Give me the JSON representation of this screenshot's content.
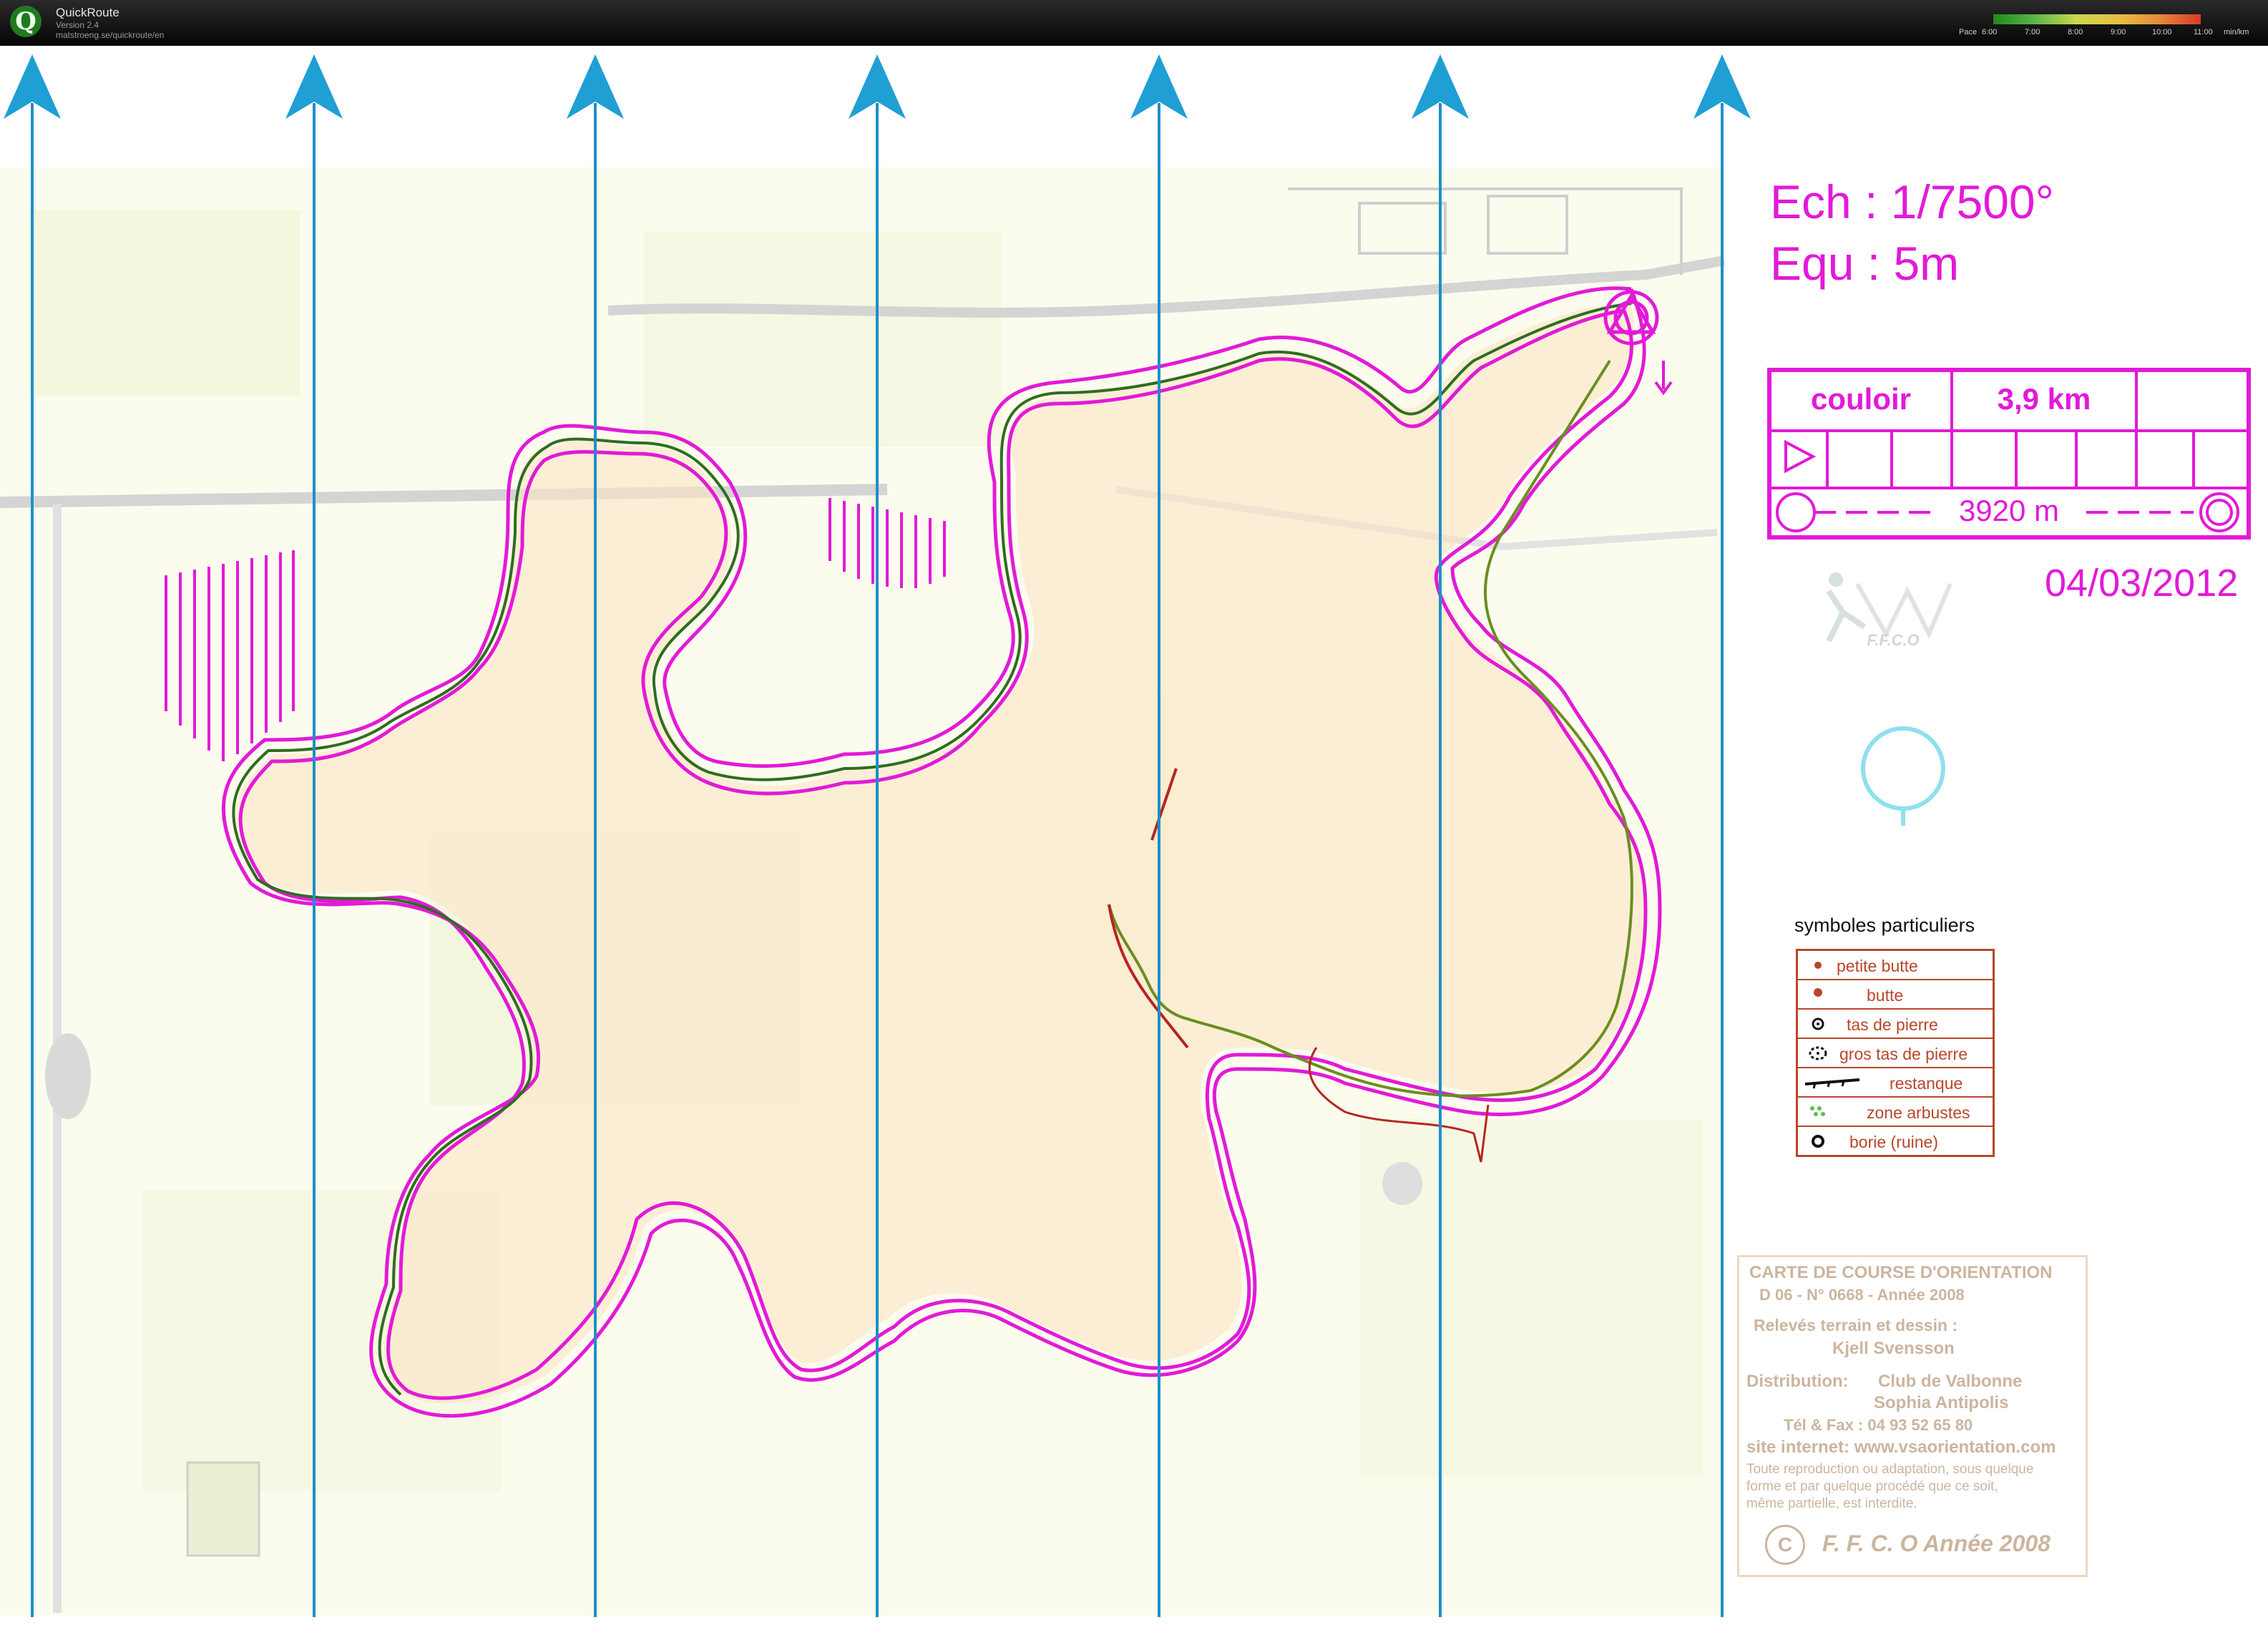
{
  "window": {
    "app_name": "QuickRoute",
    "version": "Version 2.4",
    "url": "matstroeng.se/quickroute/en"
  },
  "pace_scale": {
    "label": "Pace",
    "ticks": [
      "6:00",
      "7:00",
      "8:00",
      "9:00",
      "10:00",
      "11:00"
    ],
    "unit": "min/km",
    "colors": [
      "#1e8a1e",
      "#5bb54a",
      "#c9d94a",
      "#e8c040",
      "#e68a3a",
      "#d83a2a"
    ]
  },
  "map": {
    "scale_line": "Ech : 1/7500°",
    "contour_line": "Equ : 5m",
    "course_table": {
      "course_name": "couloir",
      "length": "3,9 km",
      "distance": "3920 m"
    },
    "date": "04/03/2012",
    "logo_text": "F.F.C.O",
    "north_arrow_count": 7,
    "course_color": "#e21ad8",
    "north_line_color": "#1f8fc9"
  },
  "legend": {
    "title": "symboles particuliers",
    "items": [
      {
        "label": "petite butte",
        "symbol": "small-knoll-icon"
      },
      {
        "label": "butte",
        "symbol": "knoll-icon"
      },
      {
        "label": "tas de pierre",
        "symbol": "stone-pile-icon"
      },
      {
        "label": "gros tas de pierre",
        "symbol": "large-stone-pile-icon"
      },
      {
        "label": "restanque",
        "symbol": "terrace-wall-icon"
      },
      {
        "label": "zone arbustes",
        "symbol": "shrub-zone-icon"
      },
      {
        "label": "borie (ruine)",
        "symbol": "ruin-hut-icon"
      }
    ]
  },
  "credits": {
    "title": "CARTE DE COURSE D'ORIENTATION",
    "ref": "D 06 - N° 0668 - Année 2008",
    "survey_label": "Relevés terrain  et dessin :",
    "surveyor": "Kjell Svensson",
    "distribution_label": "Distribution:",
    "distributor_1": "Club de Valbonne",
    "distributor_2": "Sophia Antipolis",
    "phone": "Tél & Fax : 04 93 52 65 80",
    "website": "site internet: www.vsaorientation.com",
    "notice_1": "Toute reproduction ou adaptation, sous quelque",
    "notice_2": "forme et par quelque procédé  que ce soit,",
    "notice_3": " même partielle, est interdite.",
    "copyright": "F. F. C. O Année 2008"
  }
}
